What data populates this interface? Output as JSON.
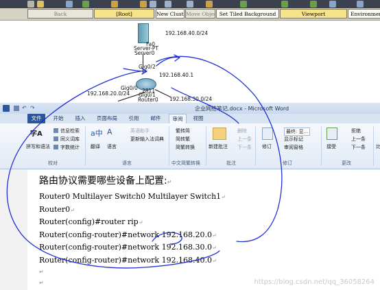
{
  "pt": {
    "nav": {
      "back": "Back",
      "root": "[Root]",
      "new_cluster": "New Cluster",
      "move_object": "Move Object",
      "set_bg": "Set Tiled Background",
      "viewport": "Viewport",
      "environment": "Environment"
    },
    "topology": {
      "server_ip": "192.168.40.0/24",
      "server_port": "Fa0",
      "server_model": "Server-PT",
      "server_name": "Server0",
      "gig02": "Gig0/2",
      "ip_40_1": "192.168.40.1",
      "gig00": "Gig0/0",
      "gig01": "Gig0/1",
      "ip_20": "192.168.20.0/24",
      "router_model": "2811",
      "router_name": "Router0",
      "ip_30": "192.168.30.0/24"
    }
  },
  "word": {
    "title": "企业网络笔记.docx - Microsoft Word",
    "tabs": [
      "文件",
      "开始",
      "插入",
      "页面布局",
      "引用",
      "邮件",
      "审阅",
      "视图"
    ],
    "ribbon": {
      "proofing": {
        "spell": "拼写和语法",
        "research": "信息检索",
        "thesaurus": "同义词库",
        "wordcount": "字数统计",
        "group": "校对"
      },
      "language": {
        "translate": "翻译",
        "language": "语言",
        "group": "语言",
        "zh_en": "英语助手",
        "ime": "更新输入法词典"
      },
      "chinese": {
        "s2t": "繁转简",
        "t2s": "简转繁",
        "conv": "简繁转换",
        "group": "中文简繁转换"
      },
      "comments": {
        "new": "新建批注",
        "delete": "删除",
        "prev": "上一条",
        "next": "下一条",
        "group": "批注"
      },
      "tracking": {
        "track": "修订",
        "final": "最终: 显...",
        "show_markup": "显示标记",
        "pane": "审阅窗格",
        "group": "修订"
      },
      "changes": {
        "accept": "接受",
        "reject": "拒绝",
        "prev": "上一条",
        "next": "下一条",
        "group": "更改"
      },
      "compare": "比"
    },
    "doc": {
      "heading": "路由协议需要哪些设备上配置:",
      "devices": "Router0   Multilayer Switch0   Multilayer Switch1",
      "router0": "Router0",
      "cmd1": "Router(config)#router  rip",
      "cmd2": "Router(config-router)#network  192.168.20.0",
      "cmd3": "Router(config-router)#network  192.168.30.0",
      "cmd4": "Router(config-router)#network  192.168.40.0",
      "para_mark": "↵"
    }
  },
  "watermark": "https://blog.csdn.net/qq_36058264",
  "colors": {
    "word_blue": "#2b579a",
    "pen_blue": "#1f2fd6",
    "pt_dark": "#3c4150"
  }
}
